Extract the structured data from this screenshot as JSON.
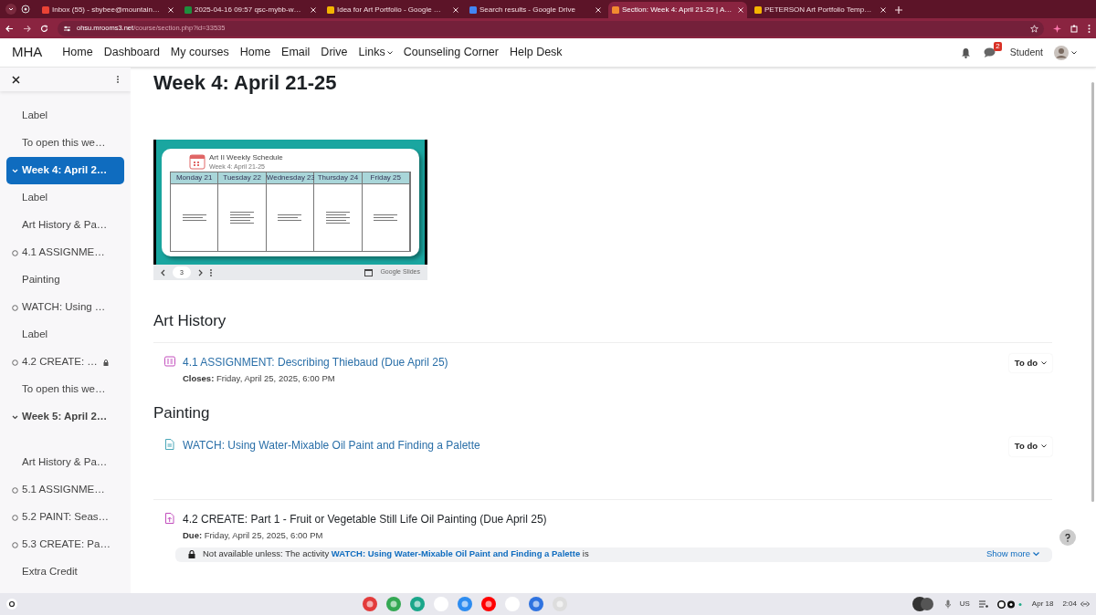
{
  "browser": {
    "tabs": [
      {
        "title": "Inbox (55) - sbybee@mountain…",
        "selected": false,
        "color": "#ea4335"
      },
      {
        "title": "2025-04-16 09:57 qsc-mybb-w…",
        "selected": false,
        "color": "#1e8e3e"
      },
      {
        "title": "Idea for Art Portfolio - Google …",
        "selected": false,
        "color": "#f4b400"
      },
      {
        "title": "Search results - Google Drive",
        "selected": false,
        "color": "#4285f4"
      },
      {
        "title": "Section: Week 4: April 21-25 | A…",
        "selected": true,
        "color": "#f28b30"
      },
      {
        "title": "PETERSON Art Portfolio Temp…",
        "selected": false,
        "color": "#f4b400"
      }
    ],
    "url_host": "ohsu.mrooms3.net",
    "url_path": "/course/section.php?id=33535"
  },
  "nav": {
    "brand": "MHA",
    "links": [
      {
        "label": "Home",
        "dropdown": false
      },
      {
        "label": "Dashboard",
        "dropdown": false
      },
      {
        "label": "My courses",
        "dropdown": false
      },
      {
        "label": "Home",
        "dropdown": false
      },
      {
        "label": "Email",
        "dropdown": false
      },
      {
        "label": "Drive",
        "dropdown": false
      },
      {
        "label": "Links",
        "dropdown": true
      },
      {
        "label": "Counseling Corner",
        "dropdown": false
      },
      {
        "label": "Help Desk",
        "dropdown": false
      }
    ],
    "message_count": "2",
    "user": "Student"
  },
  "sidebar": {
    "items": [
      {
        "kind": "label",
        "text": "Label",
        "selected": false,
        "locked": false
      },
      {
        "kind": "label",
        "text": "To open this we…",
        "selected": false,
        "locked": false
      },
      {
        "kind": "section",
        "text": "Week 4: April 2…",
        "selected": true,
        "locked": false
      },
      {
        "kind": "label",
        "text": "Label",
        "selected": false,
        "locked": false
      },
      {
        "kind": "label",
        "text": "Art History & Pa…",
        "selected": false,
        "locked": false
      },
      {
        "kind": "activity",
        "text": "4.1 ASSIGNME…",
        "selected": false,
        "locked": false
      },
      {
        "kind": "label",
        "text": "Painting",
        "selected": false,
        "locked": false
      },
      {
        "kind": "activity",
        "text": "WATCH: Using …",
        "selected": false,
        "locked": false
      },
      {
        "kind": "label",
        "text": "Label",
        "selected": false,
        "locked": false
      },
      {
        "kind": "activity",
        "text": "4.2 CREATE: …",
        "selected": false,
        "locked": true
      },
      {
        "kind": "label",
        "text": "To open this we…",
        "selected": false,
        "locked": false
      },
      {
        "kind": "section",
        "text": "Week 5: April 2…",
        "selected": false,
        "locked": false
      },
      {
        "kind": "label",
        "text": "Art History & Pa…",
        "selected": false,
        "locked": false
      },
      {
        "kind": "activity",
        "text": "5.1 ASSIGNME…",
        "selected": false,
        "locked": false
      },
      {
        "kind": "activity",
        "text": "5.2 PAINT: Seas…",
        "selected": false,
        "locked": false
      },
      {
        "kind": "activity",
        "text": "5.3 CREATE: Pa…",
        "selected": false,
        "locked": false
      },
      {
        "kind": "label",
        "text": "Extra Credit",
        "selected": false,
        "locked": false
      }
    ]
  },
  "main": {
    "title": "Week 4: April 21-25",
    "slide": {
      "title": "Art II Weekly Schedule",
      "subtitle": "Week 4: April 21-25",
      "days": [
        "Monday 21",
        "Tuesday 22",
        "Wednesday 23",
        "Thursday 24",
        "Friday 25"
      ],
      "page": "3",
      "brand": "Google Slides"
    },
    "sections": [
      {
        "heading": "Art History",
        "activities": [
          {
            "kind": "assignment",
            "title": "4.1 ASSIGNMENT: Describing Thiebaud (Due April 25)",
            "restricted": false,
            "date_label": "Closes:",
            "date": "Friday, April 25, 2025, 6:00 PM",
            "status": "To do"
          }
        ]
      },
      {
        "heading": "Painting",
        "activities": [
          {
            "kind": "page",
            "title": "WATCH: Using Water-Mixable Oil Paint and Finding a Palette",
            "restricted": false,
            "status": "To do"
          },
          {
            "kind": "submission",
            "title": "4.2 CREATE: Part 1 - Fruit or Vegetable Still Life Oil Painting (Due April 25)",
            "restricted": true,
            "date_label": "Due:",
            "date": "Friday, April 25, 2025, 6:00 PM",
            "restriction": {
              "prefix": "Not available unless: The activity",
              "link": "WATCH: Using Water-Mixable Oil Paint and Finding a Palette",
              "suffix": "is"
            },
            "show_more": "Show more"
          }
        ]
      }
    ]
  },
  "shelf": {
    "keyboard": "US",
    "date": "Apr 18",
    "time": "2:04"
  }
}
